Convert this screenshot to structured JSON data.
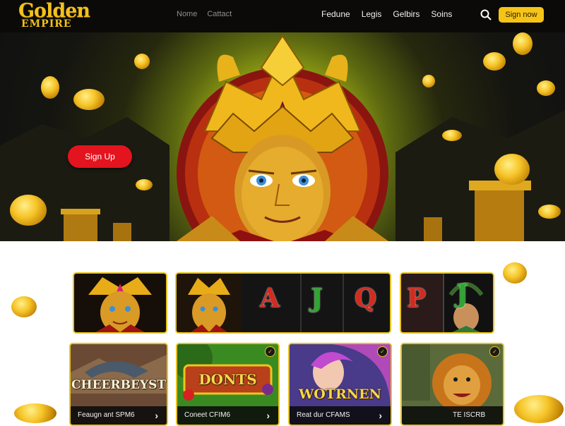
{
  "brand": {
    "line1": "Golden",
    "line2": "EMPIRE"
  },
  "nav": {
    "left": [
      "Nome",
      "Cattact"
    ],
    "right": [
      "Fedune",
      "Legis",
      "Gelbirs",
      "Soins"
    ]
  },
  "header": {
    "signup_label": "Sign now"
  },
  "hero": {
    "cta_label": "Sign Up"
  },
  "tiles_row1": [
    {
      "letters": []
    },
    {
      "letters": [
        "A",
        "J",
        "Q"
      ]
    },
    {
      "letters": [
        "P",
        "J"
      ]
    }
  ],
  "games": [
    {
      "title": "CHEERBEYST",
      "caption": "Feaugn ant SPM6"
    },
    {
      "title": "DONTS",
      "caption": "Coneet CFIM6"
    },
    {
      "title": "WOTRNEN",
      "caption": "Reat dur CFAMS"
    },
    {
      "title": "",
      "caption": "TE ISCRB"
    }
  ],
  "colors": {
    "accent": "#f5c417",
    "cta_red": "#e3141e",
    "header_bg": "#0b0a08"
  },
  "icons": [
    "search-icon",
    "chevron-right-icon"
  ]
}
